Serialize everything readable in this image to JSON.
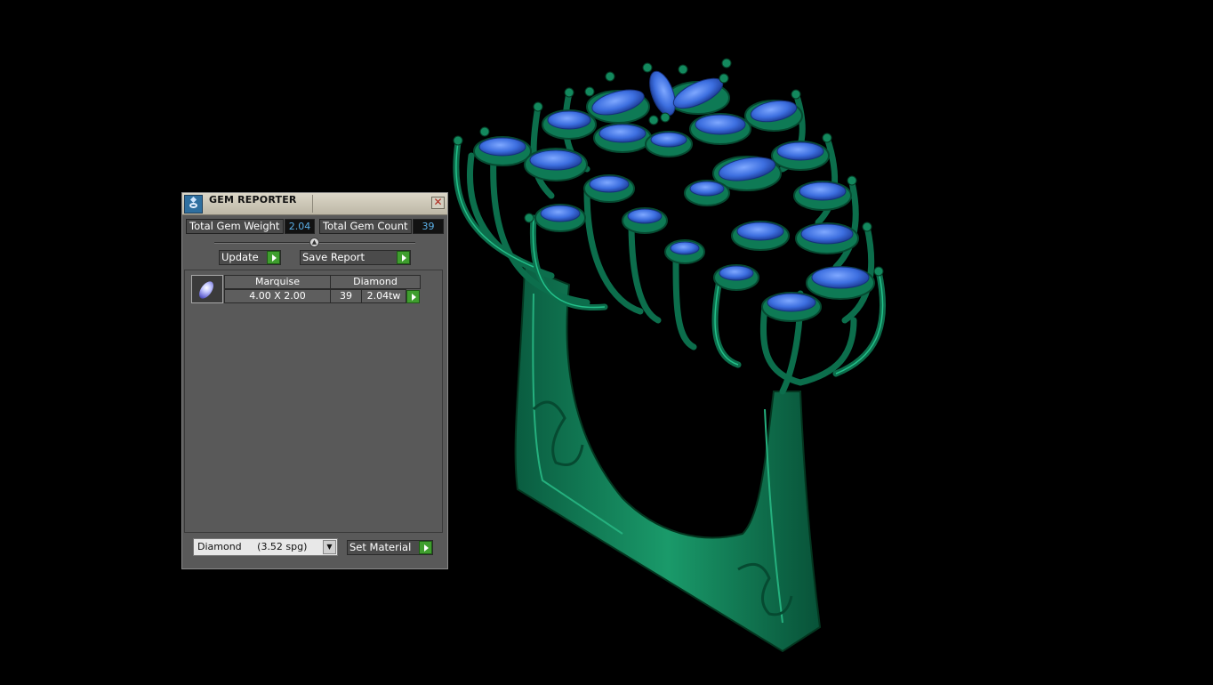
{
  "panel": {
    "title": "GEM REPORTER",
    "close_glyph": "✕",
    "total_gem_weight_label": "Total Gem Weight",
    "total_gem_weight_value": "2.04",
    "total_gem_count_label": "Total Gem Count",
    "total_gem_count_value": "39",
    "update_label": "Update",
    "save_report_label": "Save Report",
    "gems": [
      {
        "shape": "Marquise",
        "material": "Diamond",
        "size": "4.00 X 2.00",
        "count": "39",
        "weight": "2.04tw"
      }
    ],
    "material_select_value": "Diamond     (3.52 spg)",
    "set_material_label": "Set Material"
  },
  "colors": {
    "metal": "#0e7a55",
    "gem": "#3f72e0",
    "accent_button": "#3f9e2e"
  }
}
